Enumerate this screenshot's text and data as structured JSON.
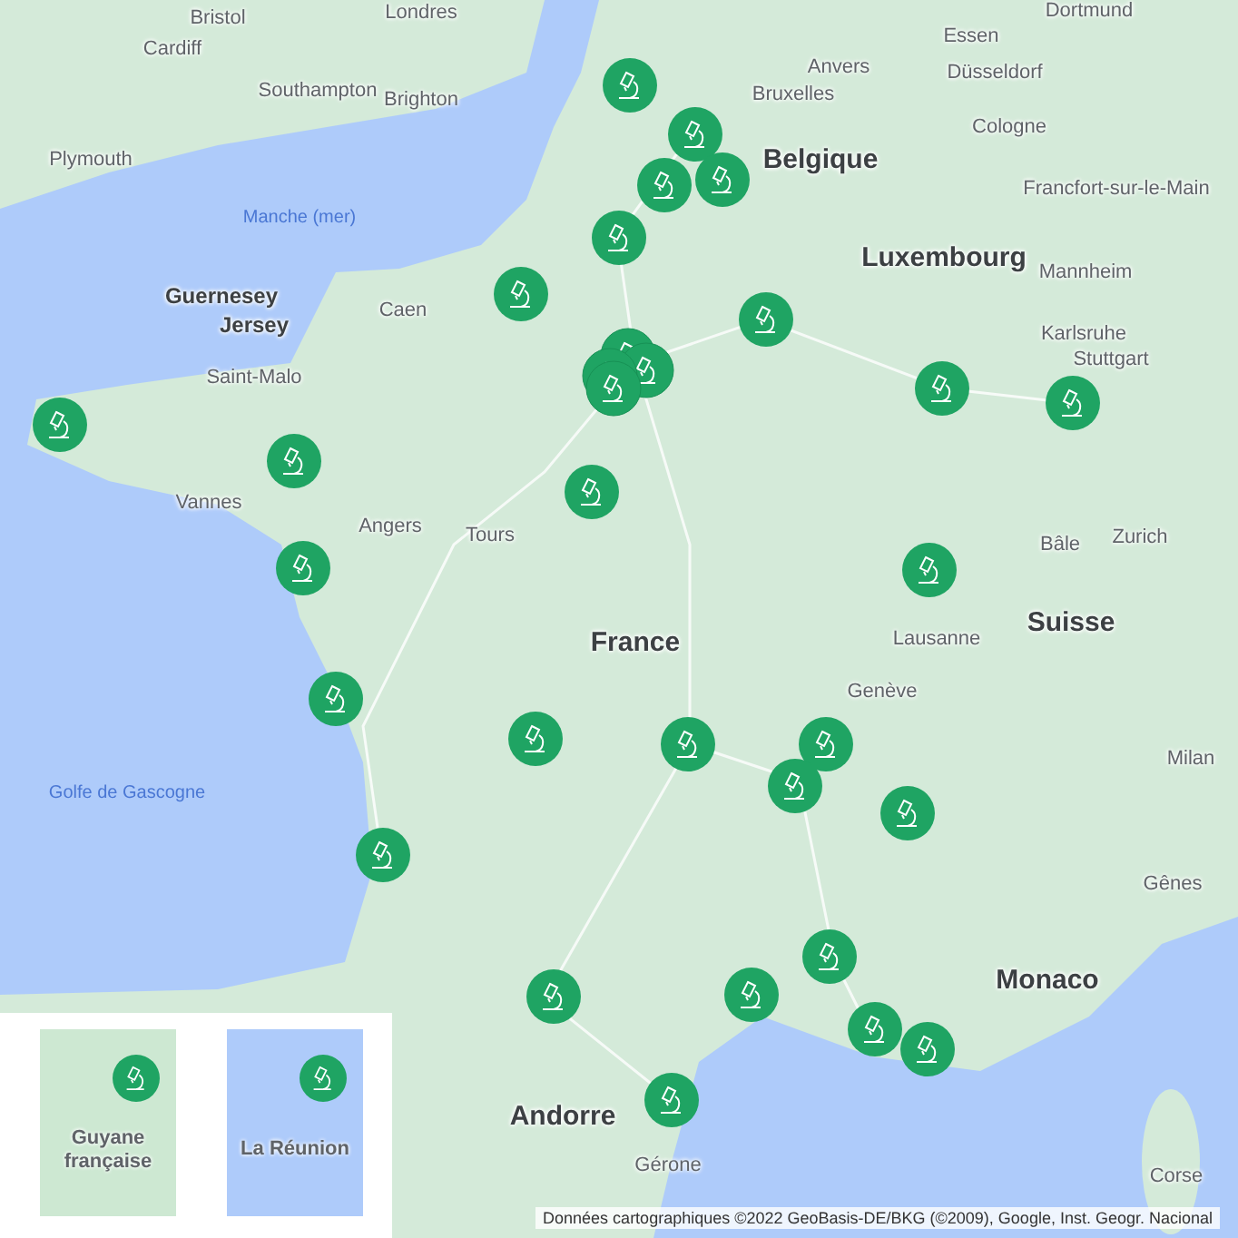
{
  "map": {
    "labels": [
      {
        "text": "Bristol",
        "kind": "city"
      },
      {
        "text": "Londres",
        "kind": "city"
      },
      {
        "text": "Cardiff",
        "kind": "city"
      },
      {
        "text": "Southampton",
        "kind": "city"
      },
      {
        "text": "Brighton",
        "kind": "city"
      },
      {
        "text": "Plymouth",
        "kind": "city"
      },
      {
        "text": "Manche (mer)",
        "kind": "sea"
      },
      {
        "text": "Guernesey",
        "kind": "region"
      },
      {
        "text": "Jersey",
        "kind": "region"
      },
      {
        "text": "Caen",
        "kind": "city"
      },
      {
        "text": "Saint-Malo",
        "kind": "city"
      },
      {
        "text": "Vannes",
        "kind": "city"
      },
      {
        "text": "Angers",
        "kind": "city"
      },
      {
        "text": "Tours",
        "kind": "city"
      },
      {
        "text": "France",
        "kind": "country"
      },
      {
        "text": "Golfe de Gascogne",
        "kind": "sea"
      },
      {
        "text": "Essen",
        "kind": "city"
      },
      {
        "text": "Dortmund",
        "kind": "city"
      },
      {
        "text": "Anvers",
        "kind": "city"
      },
      {
        "text": "Bruxelles",
        "kind": "city"
      },
      {
        "text": "Düsseldorf",
        "kind": "city"
      },
      {
        "text": "Cologne",
        "kind": "city"
      },
      {
        "text": "Belgique",
        "kind": "country"
      },
      {
        "text": "Francfort-sur-le-Main",
        "kind": "city"
      },
      {
        "text": "Luxembourg",
        "kind": "country"
      },
      {
        "text": "Mannheim",
        "kind": "city"
      },
      {
        "text": "Karlsruhe",
        "kind": "city"
      },
      {
        "text": "Stuttgart",
        "kind": "city"
      },
      {
        "text": "Zurich",
        "kind": "city"
      },
      {
        "text": "Bâle",
        "kind": "city"
      },
      {
        "text": "Suisse",
        "kind": "country"
      },
      {
        "text": "Lausanne",
        "kind": "city"
      },
      {
        "text": "Genève",
        "kind": "city"
      },
      {
        "text": "Milan",
        "kind": "city"
      },
      {
        "text": "Gênes",
        "kind": "city"
      },
      {
        "text": "Monaco",
        "kind": "country"
      },
      {
        "text": "Corse",
        "kind": "city"
      },
      {
        "text": "Andorre",
        "kind": "country"
      },
      {
        "text": "Gérone",
        "kind": "city"
      }
    ]
  },
  "insets": [
    {
      "label": "Guyane française",
      "kind": "land"
    },
    {
      "label": "La Réunion",
      "kind": "island"
    }
  ],
  "attribution": "Données cartographiques ©2022 GeoBasis-DE/BKG (©2009), Google, Inst. Geogr. Nacional"
}
